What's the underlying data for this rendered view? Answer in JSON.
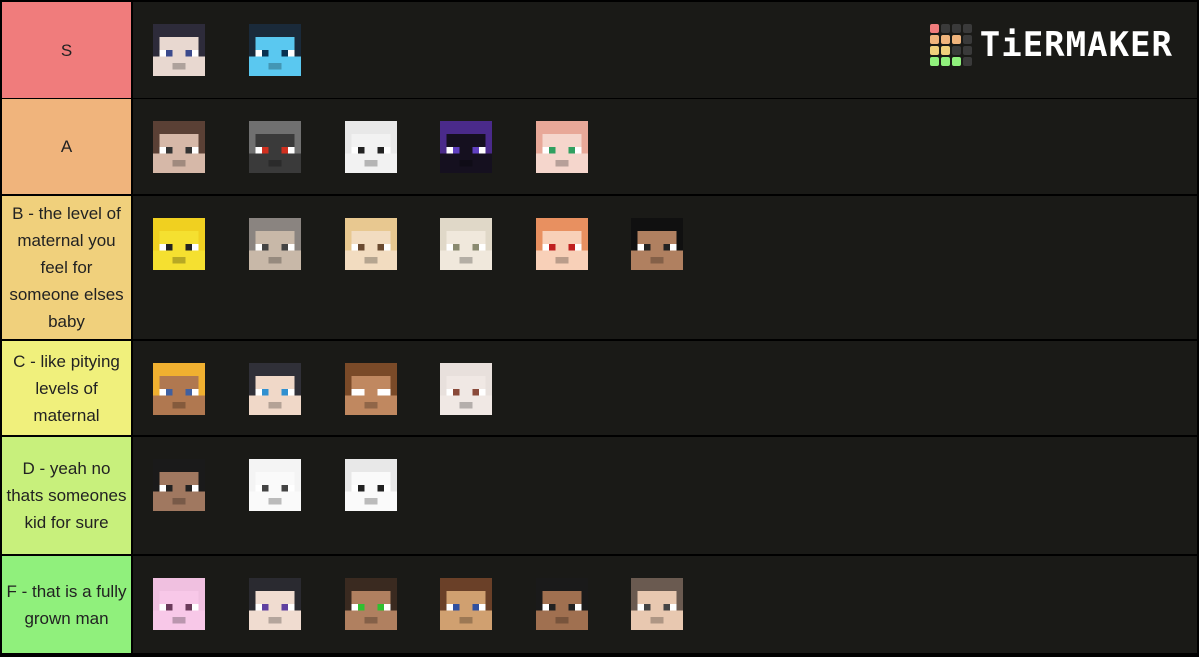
{
  "logo": {
    "text": "TiERMAKER"
  },
  "tiers": [
    {
      "label": "S",
      "color": "#f07c7c",
      "faces": [
        {
          "name": "face-dark-hair-blue-eyes",
          "hair": "#2d2b3a",
          "skin": "#e8d8d0",
          "eye": "#3b4a8c"
        },
        {
          "name": "face-blue-slime",
          "hair": "#1a2a3a",
          "skin": "#5ac8f0",
          "eye": "#0a3050"
        }
      ]
    },
    {
      "label": "A",
      "color": "#f0b47c",
      "faces": [
        {
          "name": "face-brown-hair-crown",
          "hair": "#5a4035",
          "skin": "#d6b8a8",
          "eye": "#333"
        },
        {
          "name": "face-gray-red-eyes",
          "hair": "#707070",
          "skin": "#3a3a3a",
          "eye": "#d03020"
        },
        {
          "name": "face-white-block",
          "hair": "#e8e8e8",
          "skin": "#f2f2f2",
          "eye": "#222"
        },
        {
          "name": "face-purple-black",
          "hair": "#4a2a8a",
          "skin": "#15101f",
          "eye": "#6040c0"
        },
        {
          "name": "face-pink-hair-green-eyes",
          "hair": "#e8a898",
          "skin": "#f5d6cc",
          "eye": "#30a060"
        }
      ]
    },
    {
      "label": "B - the level of maternal you feel for someone elses baby",
      "color": "#f0d07c",
      "faces": [
        {
          "name": "face-yellow-crown-smile",
          "hair": "#f0d020",
          "skin": "#f5e030",
          "eye": "#222"
        },
        {
          "name": "face-gray-hair-tan",
          "hair": "#8a8480",
          "skin": "#c8b8a8",
          "eye": "#444"
        },
        {
          "name": "face-blonde-cat-ears",
          "hair": "#e8c890",
          "skin": "#f2dcc0",
          "eye": "#6a4a30"
        },
        {
          "name": "face-cream-hair",
          "hair": "#e0d8c8",
          "skin": "#f0e8dc",
          "eye": "#8a8a70"
        },
        {
          "name": "face-orange-hair-red-eyes",
          "hair": "#e89060",
          "skin": "#f8d0b8",
          "eye": "#c02020"
        },
        {
          "name": "face-black-hair-tan",
          "hair": "#101010",
          "skin": "#b08060",
          "eye": "#222"
        }
      ]
    },
    {
      "label": "C - like pitying levels of maternal",
      "color": "#f0f07c",
      "faces": [
        {
          "name": "face-blonde-tan",
          "hair": "#f0b030",
          "skin": "#b07850",
          "eye": "#4060a0"
        },
        {
          "name": "face-black-hair-blue-eyes",
          "hair": "#303038",
          "skin": "#f0d8c8",
          "eye": "#3090d0"
        },
        {
          "name": "face-brown-hair-steve",
          "hair": "#7a4a28",
          "skin": "#c08860",
          "eye": "#fff"
        },
        {
          "name": "face-white-brown-patches",
          "hair": "#e8e0dc",
          "skin": "#f0e8e4",
          "eye": "#8a4a3a"
        }
      ]
    },
    {
      "label": "D - yeah no thats someones kid for sure",
      "color": "#c8f07c",
      "faces": [
        {
          "name": "face-hat-dark-skin",
          "hair": "#1a1a1a",
          "skin": "#a07860",
          "eye": "#222"
        },
        {
          "name": "face-white-glasses",
          "hair": "#f4f4f4",
          "skin": "#fafafa",
          "eye": "#444"
        },
        {
          "name": "face-polar-bear",
          "hair": "#e8e8e8",
          "skin": "#fafafa",
          "eye": "#222"
        }
      ]
    },
    {
      "label": "F - that is a fully grown man",
      "color": "#90f07c",
      "faces": [
        {
          "name": "face-pink-pig-crown",
          "hair": "#f0c0e0",
          "skin": "#f8c8e8",
          "eye": "#6a3a5a"
        },
        {
          "name": "face-black-hair-purple-eyes",
          "hair": "#2a2a30",
          "skin": "#f0dcd0",
          "eye": "#6040a0"
        },
        {
          "name": "face-brown-green-eyes",
          "hair": "#3a2a20",
          "skin": "#b08060",
          "eye": "#30c030"
        },
        {
          "name": "face-brown-hair-blue-eyes",
          "hair": "#6a4028",
          "skin": "#d0a070",
          "eye": "#3050a0"
        },
        {
          "name": "face-green-shirt-dark",
          "hair": "#1a1a1a",
          "skin": "#a07050",
          "eye": "#222"
        },
        {
          "name": "face-gray-brown-hair",
          "hair": "#6a5a50",
          "skin": "#e8c8b0",
          "eye": "#444"
        }
      ]
    }
  ]
}
